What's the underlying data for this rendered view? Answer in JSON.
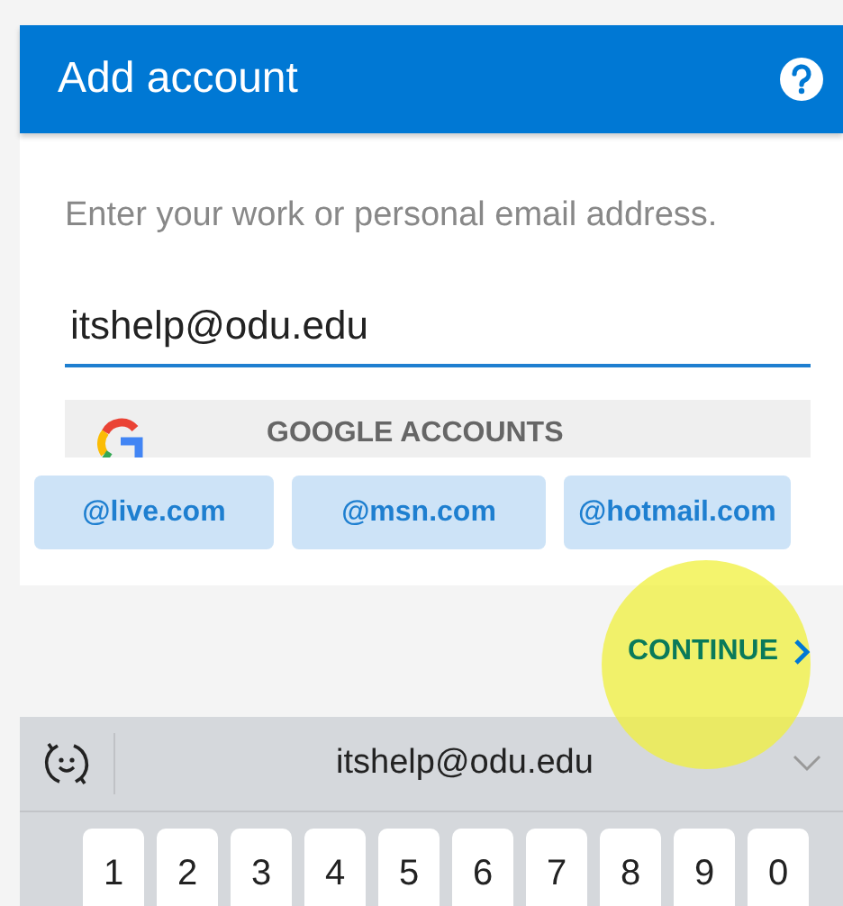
{
  "header": {
    "title": "Add account"
  },
  "instruction": "Enter your work or personal email address.",
  "email_field": {
    "value": "itshelp@odu.edu",
    "focused": true
  },
  "google_button": {
    "label": "GOOGLE ACCOUNTS"
  },
  "domain_suggestions": [
    "@live.com",
    "@msn.com",
    "@hotmail.com"
  ],
  "continue_button": {
    "label": "CONTINUE",
    "tap_highlight": true
  },
  "keyboard": {
    "suggestion": "itshelp@odu.edu",
    "keys": [
      "1",
      "2",
      "3",
      "4",
      "5",
      "6",
      "7",
      "8",
      "9",
      "0"
    ]
  }
}
